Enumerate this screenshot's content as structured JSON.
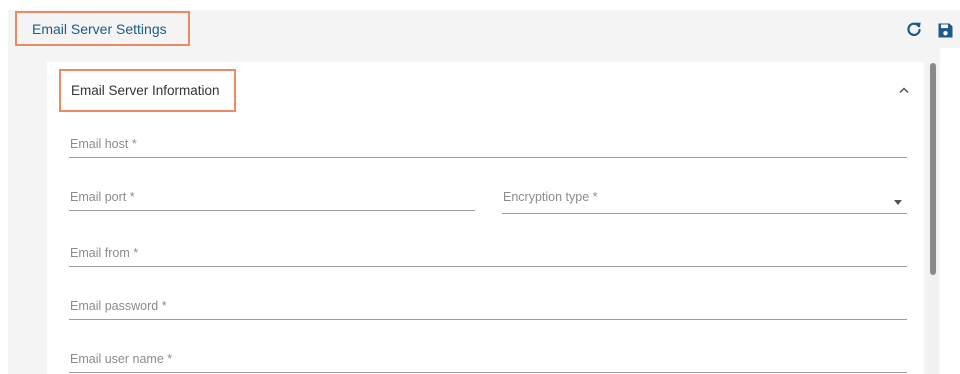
{
  "header": {
    "title": "Email Server Settings",
    "refresh_icon": "refresh-icon",
    "save_icon": "save-icon",
    "accent_color": "#1e5a85",
    "highlight_color": "#ed8a63"
  },
  "section": {
    "title": "Email Server Information",
    "collapse_icon": "chevron-up-icon"
  },
  "fields": {
    "email_host": {
      "label": "Email host *",
      "value": ""
    },
    "email_port": {
      "label": "Email port *",
      "value": ""
    },
    "encryption_type": {
      "label": "Encryption type *",
      "selected": ""
    },
    "email_from": {
      "label": "Email from *",
      "value": ""
    },
    "email_password": {
      "label": "Email password *",
      "value": ""
    },
    "email_user_name": {
      "label": "Email user name *",
      "value": ""
    }
  }
}
